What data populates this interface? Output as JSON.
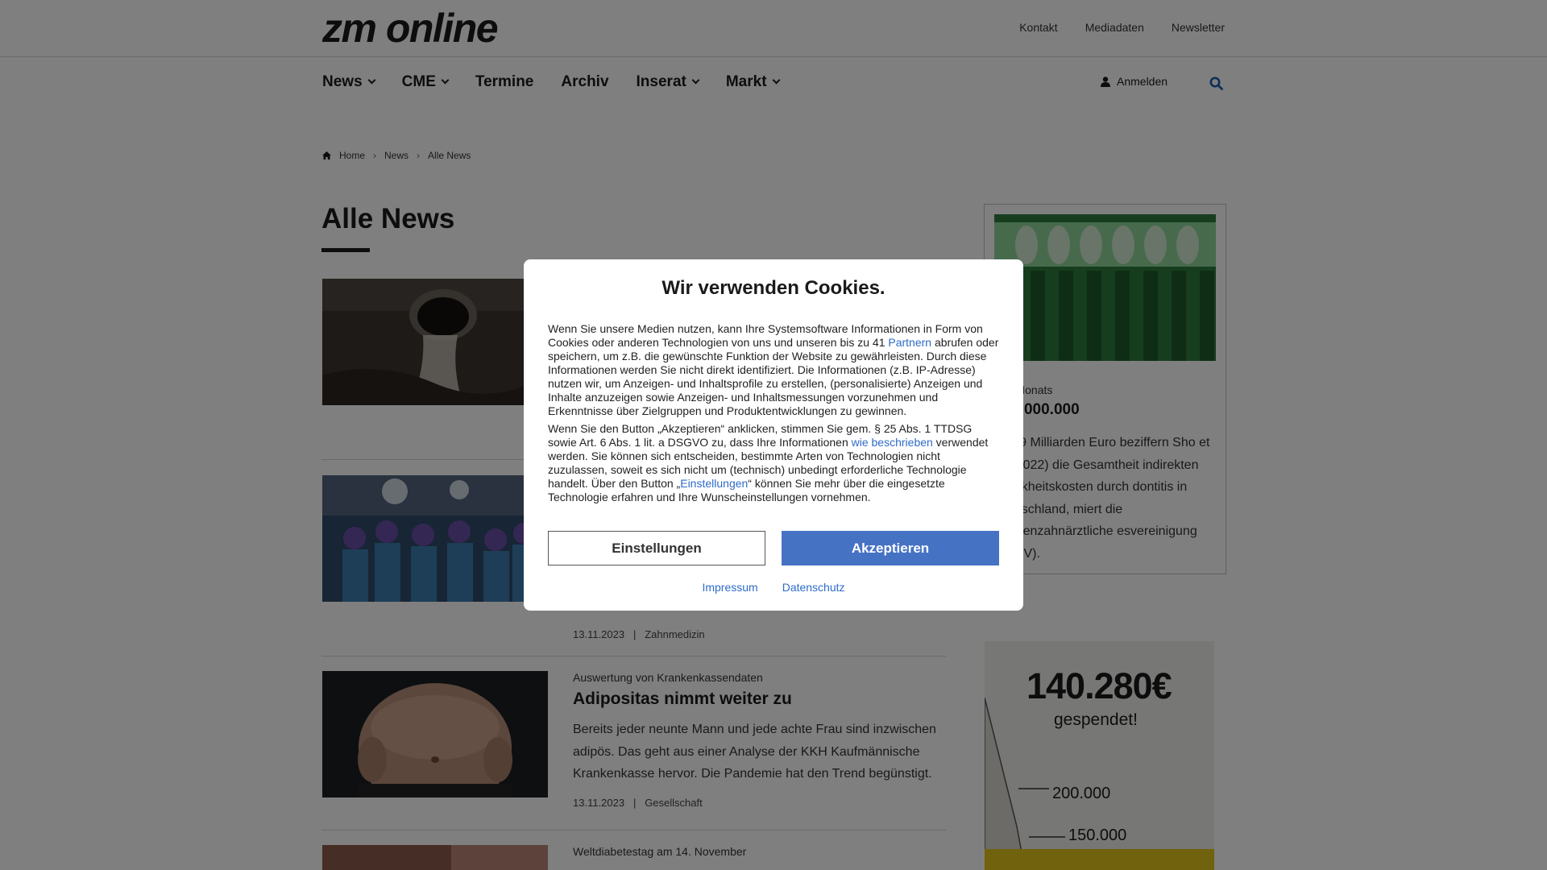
{
  "header": {
    "logo": "zm online",
    "toplinks": [
      "Kontakt",
      "Mediadaten",
      "Newsletter"
    ],
    "nav": [
      {
        "label": "News",
        "has_dropdown": true
      },
      {
        "label": "CME",
        "has_dropdown": true
      },
      {
        "label": "Termine",
        "has_dropdown": false
      },
      {
        "label": "Archiv",
        "has_dropdown": false
      },
      {
        "label": "Inserat",
        "has_dropdown": true
      },
      {
        "label": "Markt",
        "has_dropdown": true
      }
    ],
    "login_label": "Anmelden",
    "search_icon": "search-icon"
  },
  "breadcrumb": [
    "Home",
    "News",
    "Alle News"
  ],
  "page_title": "Alle News",
  "articles": [
    {
      "kicker": "",
      "headline": "",
      "teaser": "",
      "date": "",
      "category": ""
    },
    {
      "kicker": "",
      "headline": "",
      "teaser": "",
      "date": "13.11.2023",
      "category": "Zahnmedizin"
    },
    {
      "kicker": "Auswertung von Krankenkassendaten",
      "headline": "Adipositas nimmt weiter zu",
      "teaser": "Bereits jeder neunte Mann und jede achte Frau sind inzwischen adipös. Das geht aus einer Analyse der KKH Kaufmännische Krankenkasse hervor. Die Pandemie hat den Trend begünstigt.",
      "date": "13.11.2023",
      "category": "Gesellschaft"
    },
    {
      "kicker": "Weltdiabetestag am 14. November",
      "headline": "",
      "teaser": "",
      "date": "",
      "category": ""
    }
  ],
  "meta_separator": "|",
  "sidebar": {
    "label": "des Monats",
    "big_number": "790.000.000",
    "text": "34,79 Milliarden Euro beziffern Sho et al. (2022) die Gesamtheit indirekten Krankheitskosten durch dontitis in Deutschland, miert die Kassenzahnärztliche esvereinigung (KZBV)."
  },
  "donation": {
    "amount": "140.280€",
    "sub": "gespendet!",
    "marker1": "200.000",
    "marker2": "150.000"
  },
  "cookie": {
    "title": "Wir verwenden Cookies.",
    "p1_a": "Wenn Sie unsere Medien nutzen, kann Ihre Systemsoftware Informationen in Form von Cookies oder anderen Technologien von uns und unseren bis zu 41 ",
    "p1_link": "Partnern",
    "p1_b": " abrufen oder speichern, um z.B. die gewünschte Funktion der Website zu gewährleisten. Durch diese Informationen werden Sie nicht direkt identifiziert. Die Informationen (z.B. IP-Adresse) nutzen wir, um Anzeigen- und Inhaltsprofile zu erstellen, (personalisierte) Anzeigen und Inhalte anzuzeigen sowie Anzeigen- und Inhaltsmessungen vorzunehmen und Erkenntnisse über Zielgruppen und Produktentwicklungen zu gewinnen.",
    "p2_a": "Wenn Sie den Button „Akzeptieren“ anklicken, stimmen Sie gem. § 25 Abs. 1 TTDSG sowie Art. 6 Abs. 1 lit. a DSGVO zu, dass Ihre Informationen ",
    "p2_link1": "wie beschrieben",
    "p2_b": " verwendet werden. Sie können sich entscheiden, bestimmte Arten von Technologien nicht zuzulassen, soweit es sich nicht um (technisch) unbedingt erforderliche Technologie handelt. Über den Button „",
    "p2_link2": "Einstellungen",
    "p2_c": "“ können Sie mehr über die eingesetzte Technologie erfahren und Ihre Wunscheinstellungen vornehmen.",
    "btn_settings": "Einstellungen",
    "btn_accept": "Akzeptieren",
    "link_impressum": "Impressum",
    "link_datenschutz": "Datenschutz"
  },
  "colors": {
    "accent": "#4672c4",
    "link": "#2e6bc9",
    "overlay": "rgba(0,0,0,0.5)"
  }
}
